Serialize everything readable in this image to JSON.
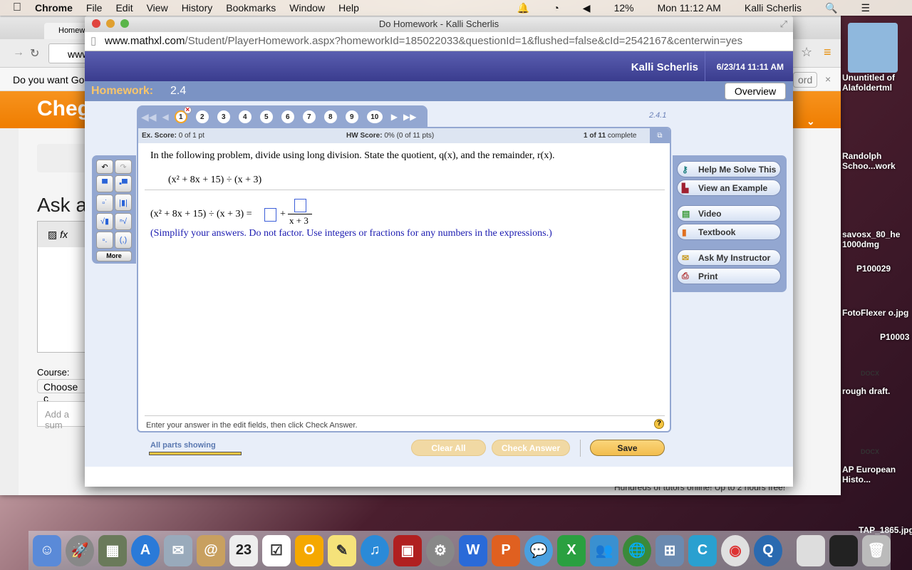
{
  "menubar": {
    "apple": "",
    "app": "Chrome",
    "items": [
      "File",
      "Edit",
      "View",
      "History",
      "Bookmarks",
      "Window",
      "Help"
    ],
    "battery": "12%",
    "clock": "Mon 11:12 AM",
    "user": "Kalli Scherlis"
  },
  "back_window": {
    "tab": "Homew",
    "url": "www",
    "infobar": "Do you want Go",
    "password_hint": "ord",
    "logo": "Cheg",
    "ask": "Ask a",
    "course_label": "Course:",
    "course_select": "Choose c",
    "summary_placeholder": "Add a sum",
    "tutors": "Hundreds of tutors online! Up to 2 hours free!"
  },
  "window": {
    "title": "Do Homework - Kalli Scherlis",
    "url_host": "www.mathxl.com",
    "url_path": "/Student/PlayerHomework.aspx?homeworkId=185022033&questionId=1&flushed=false&cId=2542167&centerwin=yes"
  },
  "header": {
    "user": "Kalli Scherlis",
    "datetime": "6/23/14 11:11 AM"
  },
  "homework": {
    "label": "Homework:",
    "name": "2.4",
    "overview": "Overview"
  },
  "nav": {
    "questions": [
      "1",
      "2",
      "3",
      "4",
      "5",
      "6",
      "7",
      "8",
      "9",
      "10"
    ],
    "current": "1",
    "section": "2.4.1"
  },
  "score": {
    "ex_label": "Ex. Score:",
    "ex_value": "0 of 1 pt",
    "hw_label": "HW Score:",
    "hw_value": "0% (0 of 11 pts)",
    "progress": "1 of 11",
    "complete": "complete"
  },
  "question": {
    "prompt": "In the following problem, divide using long division. State the quotient, q(x), and the remainder, r(x).",
    "expression": "(x² + 8x + 15) ÷ (x + 3)",
    "answer_lhs": "(x² + 8x + 15) ÷ (x + 3) =",
    "plus": "+",
    "denominator": "x + 3",
    "instruction": "(Simplify your answers. Do not factor. Use integers or fractions for any numbers in the expressions.)",
    "footer": "Enter your answer in the edit fields, then click Check Answer."
  },
  "palette": {
    "more": "More"
  },
  "tools": [
    "Help Me Solve This",
    "View an Example",
    "Video",
    "Textbook",
    "Ask My Instructor",
    "Print"
  ],
  "bottom": {
    "parts": "All parts showing",
    "clear": "Clear All",
    "check": "Check Answer",
    "save": "Save"
  },
  "desktop": [
    "Ununtitled of Alafoldertml",
    "Randolph Schoo...work",
    "savosx_80_he 1000dmg",
    "P100029",
    "FotoFlexer o.jpg",
    "P10003",
    "DOCX",
    "rough draft.",
    "DOCX",
    "AP European Histo...",
    "TAP_1865.jpg"
  ],
  "colors": {
    "accent_purple": "#3a3c8e",
    "panel_blue": "#93a7d1",
    "chegg_orange": "#f7931e",
    "save_gold": "#f2bd4e"
  }
}
